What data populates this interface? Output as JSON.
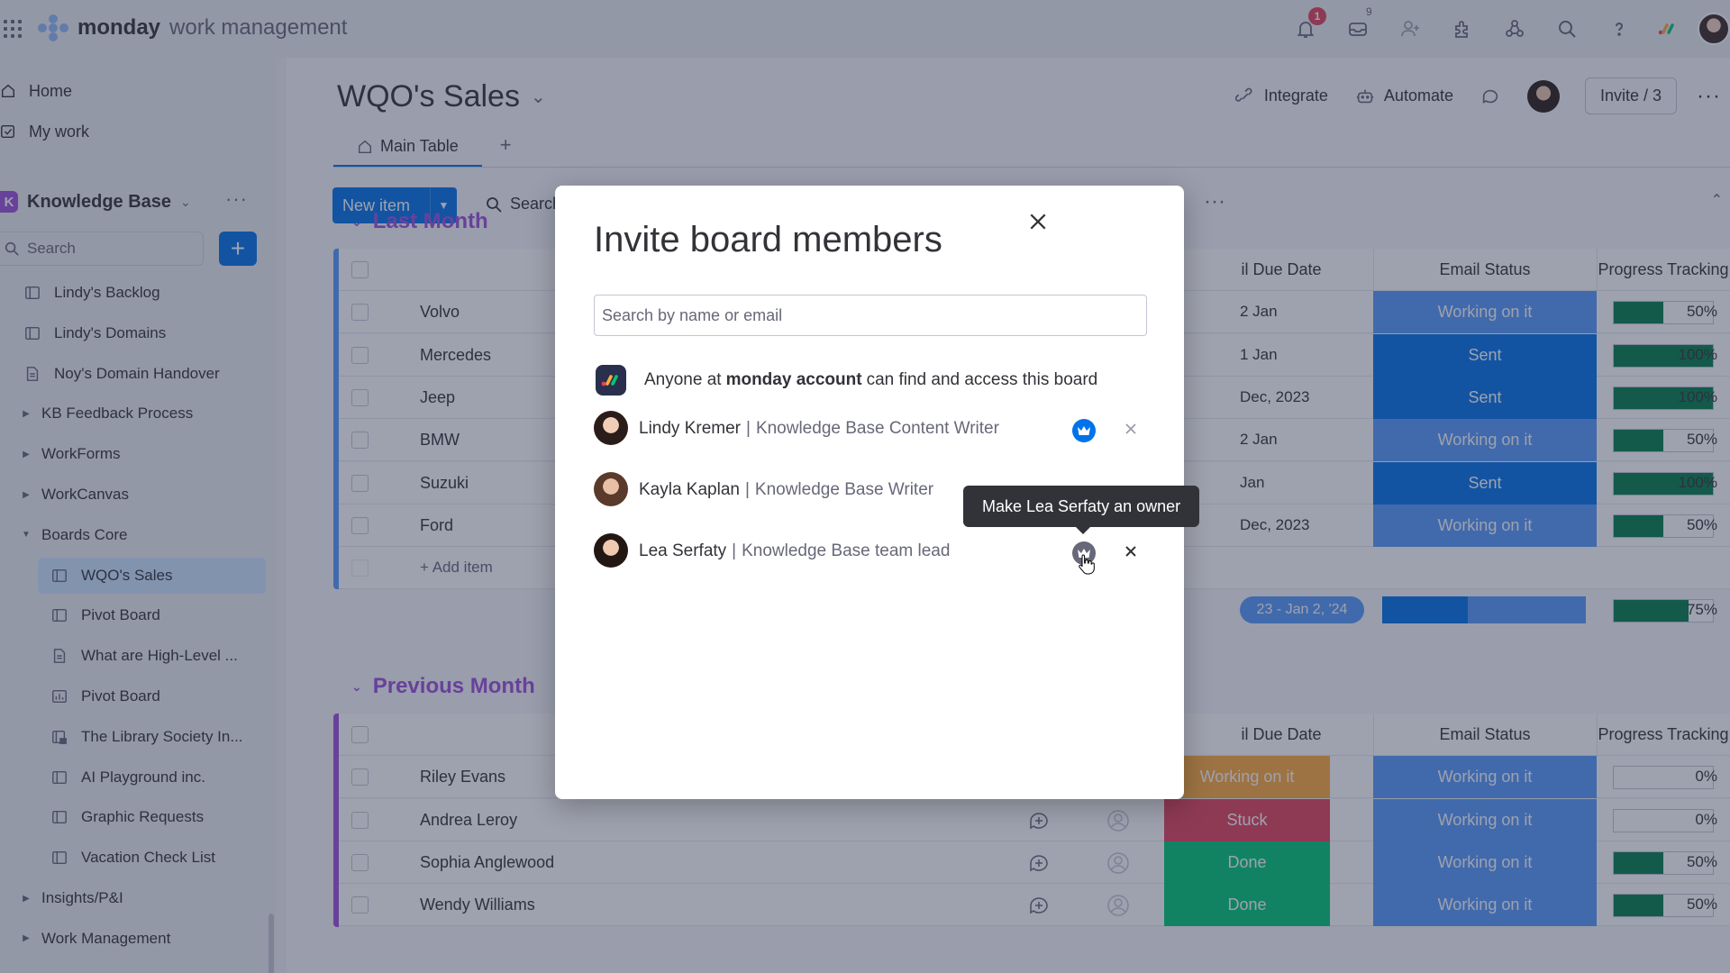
{
  "topbar": {
    "brand_bold": "monday",
    "brand_light": "work management",
    "notifications_badge": "1",
    "inbox_badge": "9",
    "icons": [
      "bell-icon",
      "inbox-icon",
      "invite-members-icon",
      "apps-icon",
      "integrations-icon",
      "search-icon",
      "help-icon"
    ]
  },
  "sidebar": {
    "home": "Home",
    "my_work": "My work",
    "workspace_letter": "K",
    "workspace_name": "Knowledge Base",
    "search_placeholder": "Search",
    "items": [
      {
        "label": "Lindy's Backlog",
        "type": "board"
      },
      {
        "label": "Lindy's Domains",
        "type": "board"
      },
      {
        "label": "Noy's Domain Handover",
        "type": "doc"
      },
      {
        "label": "KB Feedback Process",
        "type": "folder"
      },
      {
        "label": "WorkForms",
        "type": "folder"
      },
      {
        "label": "WorkCanvas",
        "type": "folder"
      },
      {
        "label": "Boards Core",
        "type": "folder-open"
      },
      {
        "label": "WQO's Sales",
        "type": "board-active"
      },
      {
        "label": "Pivot Board",
        "type": "board"
      },
      {
        "label": "What are High-Level ...",
        "type": "doc"
      },
      {
        "label": "Pivot Board",
        "type": "dashboard"
      },
      {
        "label": "The Library Society In...",
        "type": "board-lock"
      },
      {
        "label": "AI Playground inc.",
        "type": "board"
      },
      {
        "label": "Graphic Requests",
        "type": "board"
      },
      {
        "label": "Vacation Check List",
        "type": "board"
      },
      {
        "label": "Insights/P&I",
        "type": "folder"
      },
      {
        "label": "Work Management",
        "type": "folder"
      }
    ]
  },
  "board": {
    "title": "WQO's Sales",
    "integrate": "Integrate",
    "automate": "Automate",
    "invite": "Invite / 3",
    "tab_main": "Main Table",
    "new_item": "New item",
    "search": "Search",
    "columns": {
      "due_date": "il Due Date",
      "email_status": "Email Status",
      "progress": "Progress Tracking"
    },
    "groups": [
      {
        "title": "Last Month",
        "rows": [
          {
            "name": "Volvo",
            "date": "2 Jan",
            "status": "Working on it",
            "progress": 50,
            "progress_label": "50%"
          },
          {
            "name": "Mercedes",
            "date": "1 Jan",
            "status": "Sent",
            "progress": 100,
            "progress_label": "100%"
          },
          {
            "name": "Jeep",
            "date": "Dec, 2023",
            "status": "Sent",
            "progress": 100,
            "progress_label": "100%"
          },
          {
            "name": "BMW",
            "date": "2 Jan",
            "status": "Working on it",
            "progress": 50,
            "progress_label": "50%"
          },
          {
            "name": "Suzuki",
            "date": "Jan",
            "status": "Sent",
            "progress": 100,
            "progress_label": "100%"
          },
          {
            "name": "Ford",
            "date": "Dec, 2023",
            "status": "Working on it",
            "progress": 50,
            "progress_label": "50%"
          }
        ],
        "add_item": "+ Add item",
        "summary_date": "23 - Jan 2, '24",
        "summary_progress": 75,
        "summary_progress_label": "75%"
      },
      {
        "title": "Previous Month",
        "rows": [
          {
            "name": "Riley Evans",
            "owner_status": "Working on it",
            "status": "Working on it",
            "progress": 0,
            "progress_label": "0%"
          },
          {
            "name": "Andrea Leroy",
            "owner_status": "Stuck",
            "status": "Working on it",
            "progress": 0,
            "progress_label": "0%"
          },
          {
            "name": "Sophia Anglewood",
            "owner_status": "Done",
            "status": "Working on it",
            "progress": 50,
            "progress_label": "50%"
          },
          {
            "name": "Wendy Williams",
            "owner_status": "Done",
            "status": "Working on it",
            "progress": 50,
            "progress_label": "50%"
          }
        ]
      }
    ],
    "colors": {
      "working": "#fdab3d",
      "sent": "#0073ea",
      "working_blue": "#579bfc",
      "stuck": "#e2445c",
      "done": "#00c875",
      "progress": "#037f4c",
      "group": "#9d50dd"
    }
  },
  "modal": {
    "title": "Invite board members",
    "search_placeholder": "Search by name or email",
    "access_prefix": "Anyone at",
    "access_account": "monday account",
    "access_suffix": "can find and access this board",
    "members": [
      {
        "name": "Lindy Kremer",
        "role": "Knowledge Base Content Writer",
        "owner": true
      },
      {
        "name": "Kayla Kaplan",
        "role": "Knowledge Base Writer",
        "owner": false
      },
      {
        "name": "Lea Serfaty",
        "role": "Knowledge Base team lead",
        "owner": false
      }
    ],
    "separator": "|",
    "tooltip": "Make Lea Serfaty an owner"
  }
}
